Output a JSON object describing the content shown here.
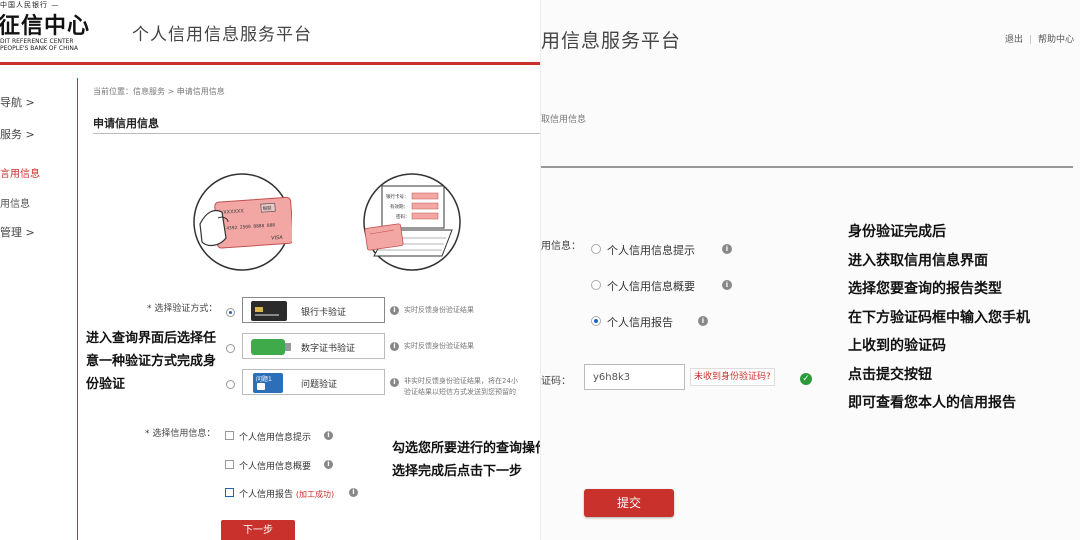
{
  "colors": {
    "accent": "#c8312c",
    "radio_blue": "#1c64c4",
    "success_green": "#2a9a3a"
  },
  "left": {
    "logo": {
      "top_text": "中国人民银行 —",
      "cn_text": "征信中心",
      "en_line1": "DIT REFERENCE CENTER",
      "en_line2": "PEOPLE'S BANK OF CHINA"
    },
    "site_title": "个人信用信息服务平台",
    "sidebar": [
      {
        "label": "导航 >"
      },
      {
        "label": "服务 >"
      },
      {
        "label": "言用信息"
      },
      {
        "label": "用信息"
      },
      {
        "label": "管理 >"
      }
    ],
    "breadcrumb": "当前位置：信息服务 > 申请信用信息",
    "section_title": "申请信用信息",
    "illustration": {
      "card_label": "XXXXXX",
      "card_bank": "银联",
      "card_number": "4392 2500 8888 888",
      "card_brand": "VISA",
      "form_field1": "银行卡号：",
      "form_field2": "有效期：",
      "form_field3": "密码："
    },
    "verify": {
      "label": "* 选择验证方式：",
      "options": [
        {
          "label": "银行卡验证",
          "hint": "实时反馈身份验证结果",
          "selected": true,
          "icon": "bank-card-icon"
        },
        {
          "label": "数字证书验证",
          "hint": "实时反馈身份验证结果",
          "selected": false,
          "icon": "digital-certificate-icon"
        },
        {
          "label": "问题验证",
          "hint": "非实时反馈身份验证结果，将在24小",
          "hint2": "验证结果以短信方式发送到您预留的",
          "icon_text": "问题1",
          "selected": false,
          "icon": "question-icon"
        }
      ]
    },
    "info_type": {
      "label": "* 选择信用信息：",
      "options": [
        {
          "label": "个人信用信息提示",
          "checked": false
        },
        {
          "label": "个人信用信息概要",
          "checked": false
        },
        {
          "label": "个人信用报告",
          "checked": true,
          "status": "(加工成功)"
        }
      ]
    },
    "next_button": "下一步",
    "annotations": {
      "verify_note": [
        "进入查询界面后选择任",
        "意一种验证方式完成身",
        "份验证"
      ],
      "select_note": [
        "勾选您所要进行的查询操作",
        "选择完成后点击下一步"
      ]
    }
  },
  "right": {
    "title": "用信息服务平台",
    "top_links": {
      "logout": "退出",
      "separator": "|",
      "help": "帮助中心"
    },
    "breadcrumb": "取信用信息",
    "info_label": "用信息：",
    "options": [
      {
        "label": "个人信用信息提示",
        "selected": false
      },
      {
        "label": "个人信用信息概要",
        "selected": false
      },
      {
        "label": "个人信用报告",
        "selected": true
      }
    ],
    "code_label": "证码：",
    "code_value": "y6h8k3",
    "code_link": "未收到身份验证码?",
    "submit_button": "提交",
    "annotations": [
      "身份验证完成后",
      "进入获取信用信息界面",
      "选择您要查询的报告类型",
      "在下方验证码框中输入您手机",
      "上收到的验证码",
      "点击提交按钮",
      "即可查看您本人的信用报告"
    ]
  }
}
